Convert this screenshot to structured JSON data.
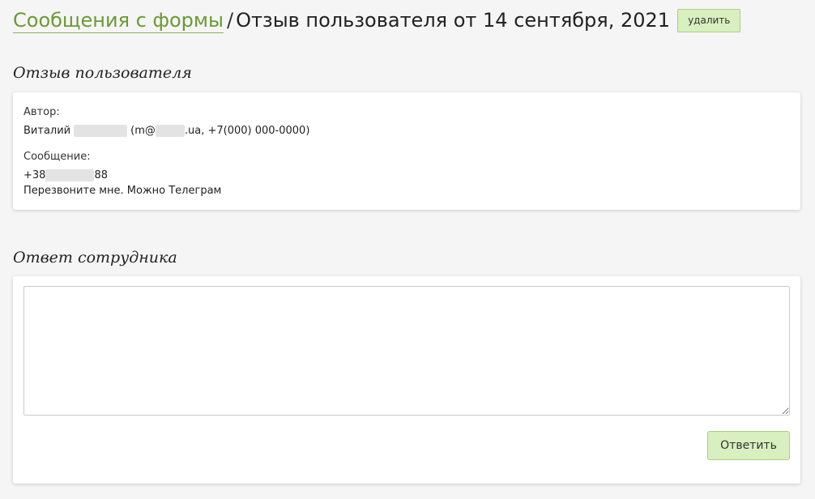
{
  "breadcrumb": {
    "link_label": "Сообщения с формы",
    "separator": "/",
    "title": "Отзыв пользователя от 14 сентября, 2021"
  },
  "actions": {
    "delete_label": "удалить"
  },
  "feedback": {
    "section_title": "Отзыв пользователя",
    "author_label": "Автор:",
    "author_name": "Виталий",
    "author_email_prefix": "(m@",
    "author_contact_suffix": ".ua, +7(000) 000-0000)",
    "message_label": "Сообщение:",
    "phone_prefix": "+38",
    "phone_suffix": "88",
    "message_text": "Перезвоните мне. Можно Телеграм"
  },
  "reply": {
    "section_title": "Ответ сотрудника",
    "textarea_value": "",
    "submit_label": "Ответить"
  },
  "colors": {
    "link": "#6b9a34",
    "button_bg": "#d8efbf",
    "button_border": "#a9cf87",
    "page_bg": "#f5f5f5"
  }
}
